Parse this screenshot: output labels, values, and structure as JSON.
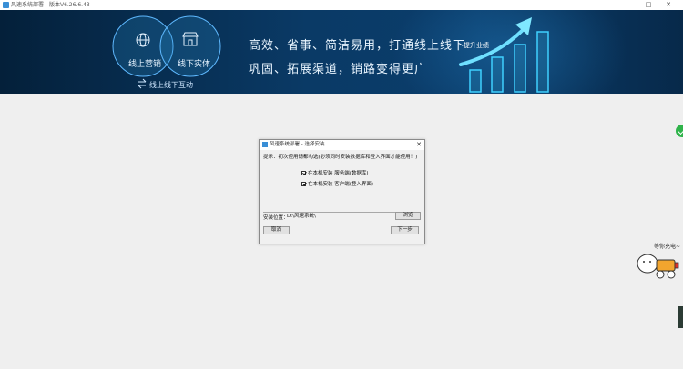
{
  "window": {
    "title": "风速系统部署 - 版本V6.26.6.43",
    "controls": {
      "minimize": "—",
      "maximize": "□",
      "close": "✕"
    }
  },
  "banner": {
    "circle_left_label": "线上营销",
    "circle_right_label": "线下实体",
    "interaction_label": "线上线下互动",
    "slogan_line1": "高效、省事、简洁易用，打通线上线下",
    "slogan_line2": "巩固、拓展渠道，销路变得更广",
    "growth_label": "提升业绩",
    "icons": [
      "globe-icon",
      "store-icon",
      "swap-arrows-icon",
      "growth-arrow-icon"
    ],
    "colors": {
      "background": "#0a3a66",
      "accent": "#3fd0ff"
    }
  },
  "dialog": {
    "title": "风速系统部署 - 选择安装",
    "close": "✕",
    "hint": "提示：初次使用请都勾选(必须同时安装数据库和登入界面才能使用！)",
    "options": [
      {
        "label": "在本机安装 服务端(数据库)",
        "checked": true
      },
      {
        "label": "在本机安装 客户端(登入界面)",
        "checked": true
      }
    ],
    "path_label": "安装位置：",
    "path_value": "D:\\风速系统\\",
    "browse_button": "浏览",
    "cancel_button": "取消",
    "next_button": "下一步"
  },
  "side_widget": {
    "mascot_text": "等你充电~"
  }
}
